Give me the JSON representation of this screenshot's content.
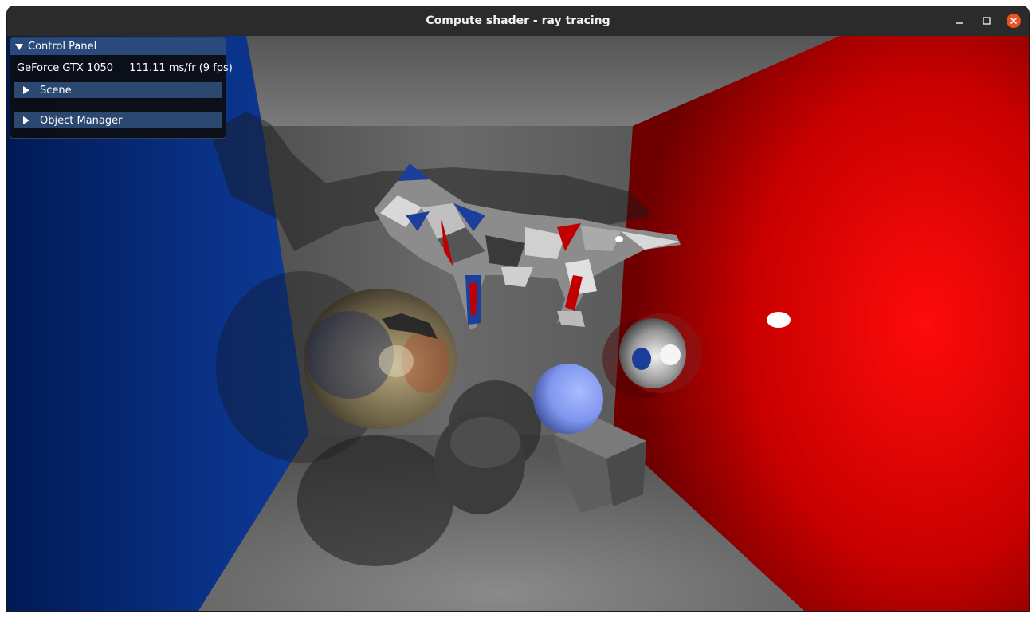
{
  "window": {
    "title": "Compute shader - ray tracing",
    "controls": [
      "minimize-icon",
      "maximize-icon",
      "close-icon"
    ]
  },
  "panel": {
    "title": "Control Panel",
    "gpu": "GeForce GTX 1050",
    "timing": "111.11 ms/fr (9 fps)",
    "sections": [
      {
        "label": "Scene",
        "expanded": false
      },
      {
        "label": "Object Manager",
        "expanded": false
      }
    ]
  },
  "colors": {
    "titlebar": "#2b2b2b",
    "close_button": "#e95420",
    "panel_header": "#294a7a",
    "section_header": "#2a4870",
    "left_wall": "#0a2f7a",
    "right_wall": "#d80000",
    "floor": "#6a6a6a"
  }
}
